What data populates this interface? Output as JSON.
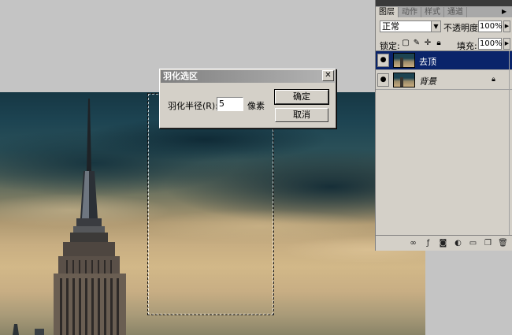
{
  "dialog": {
    "title": "羽化选区",
    "close_glyph": "✕",
    "radius_label": "羽化半径(R):",
    "radius_value": "5",
    "unit": "像素",
    "ok_label": "确定",
    "cancel_label": "取消"
  },
  "layers_panel": {
    "tabs": [
      {
        "label": "图层",
        "active": true
      },
      {
        "label": "动作",
        "active": false
      },
      {
        "label": "样式",
        "active": false
      },
      {
        "label": "通道",
        "active": false
      }
    ],
    "blend_mode": "正常",
    "opacity_label": "不透明度:",
    "opacity_value": "100%",
    "lock_label": "锁定:",
    "fill_label": "填充:",
    "fill_value": "100%",
    "layers": [
      {
        "name": "去顶",
        "selected": true,
        "italic": false,
        "locked": false
      },
      {
        "name": "背景",
        "selected": false,
        "italic": true,
        "locked": true
      }
    ]
  },
  "icons": {
    "eye": "eye-icon",
    "lock": "lock-icon",
    "link": "link-icon",
    "fx": "fx-icon",
    "mask": "mask-icon",
    "adjust": "adjustment-icon",
    "folder": "folder-icon",
    "new_layer": "new-layer-icon",
    "trash": "trash-icon"
  },
  "colors": {
    "selected_layer": "#0a246a",
    "dialog_bg": "#d4d0c8",
    "workspace": "#c4c4c4"
  }
}
